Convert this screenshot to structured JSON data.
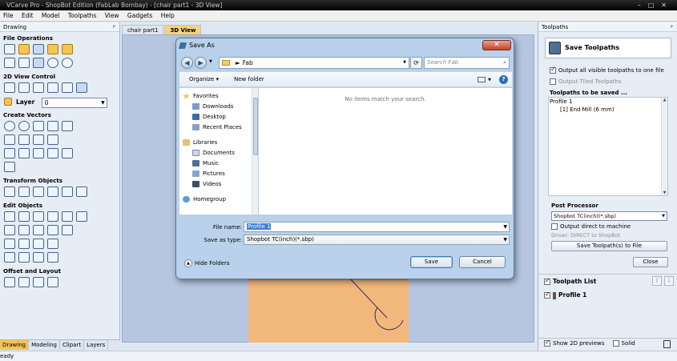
{
  "app": {
    "title": "VCarve Pro - ShopBot Edition (FabLab Bombay) - [chair part1 - 3D View]",
    "window_controls": [
      "–",
      "□",
      "✕"
    ]
  },
  "menu": [
    "File",
    "Edit",
    "Model",
    "Toolpaths",
    "View",
    "Gadgets",
    "Help"
  ],
  "left_panel": {
    "title": "Drawing",
    "pin": "ᵖ",
    "sections": {
      "file_operations": "File Operations",
      "view_control": "2D View Control",
      "create_vectors": "Create Vectors",
      "transform_objects": "Transform Objects",
      "edit_objects": "Edit Objects",
      "offset_layout": "Offset and Layout"
    },
    "layer_label": "Layer",
    "layer_value": "0",
    "tabs": [
      "Drawing",
      "Modeling",
      "Clipart",
      "Layers"
    ]
  },
  "view_tabs": [
    "chair part1",
    "3D View"
  ],
  "status": "eady",
  "right_panel": {
    "title": "Toolpaths",
    "pin": "ᵖ",
    "save_title": "Save Toolpaths",
    "opt_all_visible": "Output all visible toolpaths to one file",
    "opt_tiled": "Output Tiled Toolpaths",
    "to_be_saved": "Toolpaths to be saved ...",
    "list": [
      "Profile 1",
      "[1] End Mill (6 mm)"
    ],
    "post_processor_label": "Post Processor",
    "post_processor_value": "Shopbot TC(inch)(*.sbp)",
    "opt_direct": "Output direct to machine",
    "driver_text": "Driver: DIRECT to ShopBot",
    "save_button": "Save Toolpath(s) to File",
    "close_button": "Close",
    "toolpath_list": "Toolpath List",
    "profile_item": "Profile 1",
    "show_2d": "Show 2D previews",
    "solid": "Solid"
  },
  "dialog": {
    "title": "Save As",
    "close": "✕",
    "address": "Fab",
    "search_placeholder": "Search Fab",
    "organize": "Organize ▾",
    "new_folder": "New folder",
    "help": "?",
    "nav": {
      "favorites": "Favorites",
      "downloads": "Downloads",
      "desktop": "Desktop",
      "recent": "Recent Places",
      "libraries": "Libraries",
      "documents": "Documents",
      "music": "Music",
      "pictures": "Pictures",
      "videos": "Videos",
      "homegroup": "Homegroup"
    },
    "empty_message": "No items match your search.",
    "file_name_label": "File name:",
    "file_name_value": "Profile 1",
    "save_type_label": "Save as type:",
    "save_type_value": "Shopbot TC(inch)(*.sbp)",
    "hide_folders": "Hide Folders",
    "save_button": "Save",
    "cancel_button": "Cancel"
  },
  "colors": {
    "accent": "#f5c453",
    "viewport": "#b6c6e0",
    "sheet": "#f2b87b",
    "dialog_frame": "#b9d1ea"
  }
}
